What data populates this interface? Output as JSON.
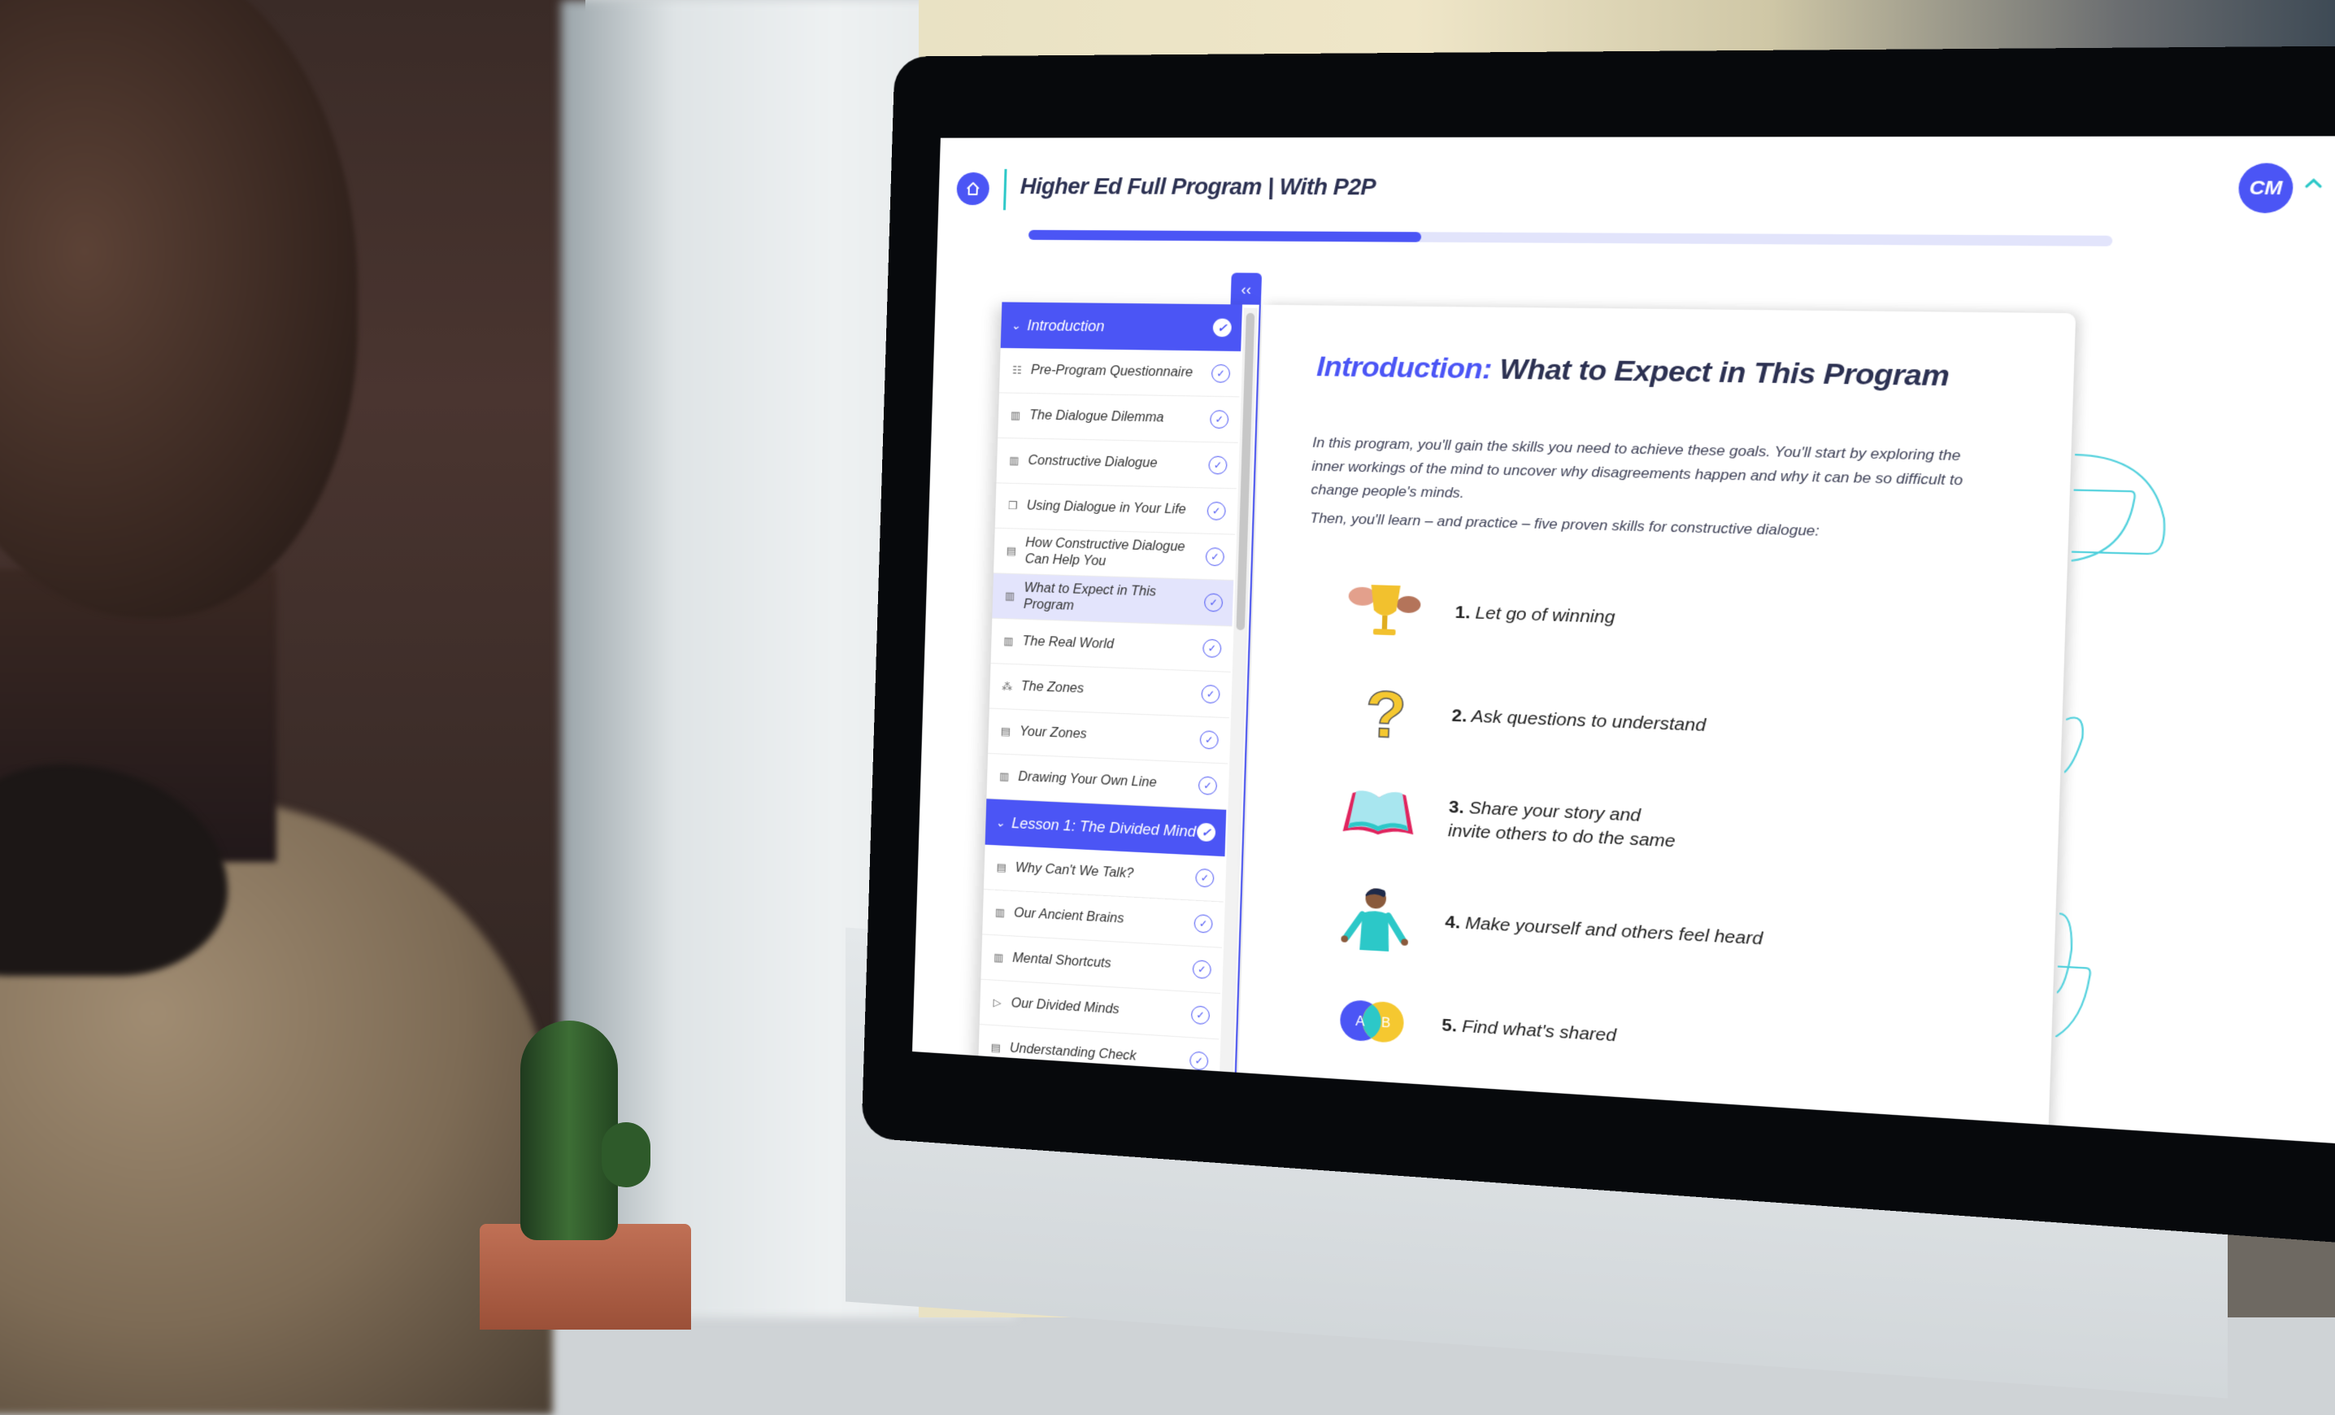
{
  "app": {
    "title": "Higher Ed Full Program | With P2P",
    "user_initials": "CM",
    "progress_percent": 38,
    "sidebar_toggle_label": "‹‹"
  },
  "colors": {
    "accent": "#4b55f5",
    "teal": "#2cc8c8",
    "title_text": "#2c3152",
    "active_row": "#e3e4fc"
  },
  "sidebar": {
    "sections": [
      {
        "title": "Introduction",
        "completed": true,
        "items": [
          {
            "label": "Pre-Program Questionnaire",
            "icon": "survey-icon",
            "completed": true,
            "active": false
          },
          {
            "label": "The Dialogue Dilemma",
            "icon": "book-icon",
            "completed": true,
            "active": false
          },
          {
            "label": "Constructive Dialogue",
            "icon": "book-icon",
            "completed": true,
            "active": false
          },
          {
            "label": "Using Dialogue in Your Life",
            "icon": "copy-icon",
            "completed": true,
            "active": false
          },
          {
            "label": "How Constructive Dialogue Can Help You",
            "icon": "quiz-icon",
            "completed": true,
            "active": false
          },
          {
            "label": "What to Expect in This Program",
            "icon": "book-icon",
            "completed": true,
            "active": true
          },
          {
            "label": "The Real World",
            "icon": "book-icon",
            "completed": true,
            "active": false
          },
          {
            "label": "The Zones",
            "icon": "network-icon",
            "completed": true,
            "active": false
          },
          {
            "label": "Your Zones",
            "icon": "quiz-icon",
            "completed": true,
            "active": false
          },
          {
            "label": "Drawing Your Own Line",
            "icon": "book-icon",
            "completed": true,
            "active": false
          }
        ]
      },
      {
        "title": "Lesson 1: The Divided Mind",
        "completed": true,
        "items": [
          {
            "label": "Why Can't We Talk?",
            "icon": "quiz-icon",
            "completed": true,
            "active": false
          },
          {
            "label": "Our Ancient Brains",
            "icon": "book-icon",
            "completed": true,
            "active": false
          },
          {
            "label": "Mental Shortcuts",
            "icon": "book-icon",
            "completed": true,
            "active": false
          },
          {
            "label": "Our Divided Minds",
            "icon": "video-icon",
            "completed": true,
            "active": false
          },
          {
            "label": "Understanding Check",
            "icon": "quiz-icon",
            "completed": true,
            "active": false
          }
        ]
      }
    ]
  },
  "content": {
    "title_prefix": "Introduction:",
    "title_main": "What to Expect in This Program",
    "paragraph_1": "In this program, you'll gain the skills you need to achieve these goals. You'll start by exploring the inner workings of the mind to uncover why disagreements happen and why it can be so difficult to change people's minds.",
    "paragraph_2": "Then, you'll learn – and practice – five proven skills for constructive dialogue:",
    "skills": [
      {
        "number": "1.",
        "text": "Let go of winning",
        "icon": "trophy-icon"
      },
      {
        "number": "2.",
        "text": "Ask questions to understand",
        "icon": "question-mark-icon"
      },
      {
        "number": "3.",
        "text": "Share your story and invite others to do the same",
        "icon": "open-book-icon"
      },
      {
        "number": "4.",
        "text": "Make yourself and others feel heard",
        "icon": "person-icon"
      },
      {
        "number": "5.",
        "text": "Find what's shared",
        "icon": "venn-diagram-icon",
        "venn_labels": [
          "A",
          "B"
        ]
      }
    ]
  }
}
